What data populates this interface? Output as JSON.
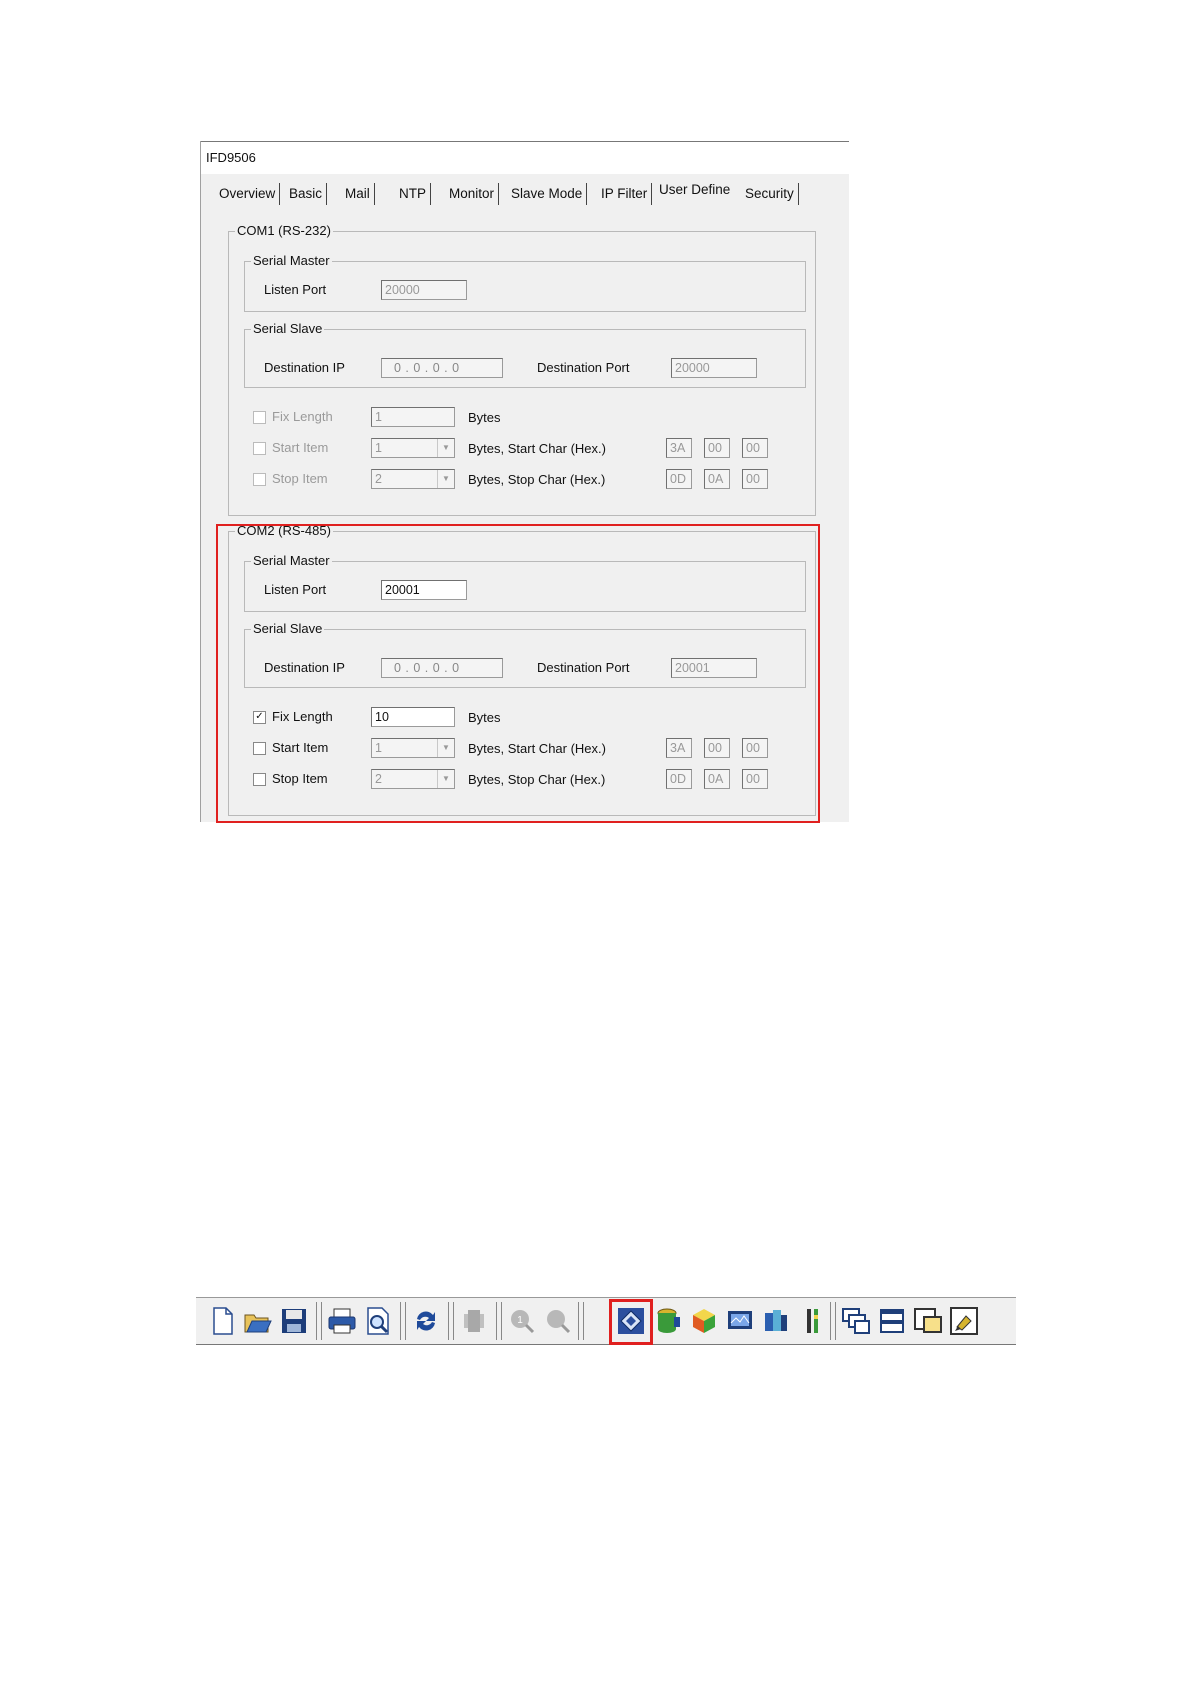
{
  "window": {
    "title": "IFD9506"
  },
  "tabs": [
    "Overview",
    "Basic",
    "Mail",
    "NTP",
    "Monitor",
    "Slave Mode",
    "IP Filter",
    "User Define",
    "Security"
  ],
  "com1": {
    "title": "COM1 (RS-232)",
    "serial_master": {
      "title": "Serial Master",
      "listen_port_label": "Listen Port",
      "listen_port": "20000"
    },
    "serial_slave": {
      "title": "Serial Slave",
      "dest_ip_label": "Destination IP",
      "dest_ip": "0 . 0 . 0 . 0",
      "dest_port_label": "Destination Port",
      "dest_port": "20000"
    },
    "fix_length": {
      "label": "Fix Length",
      "value": "1",
      "unit": "Bytes",
      "checked": false
    },
    "start_item": {
      "label": "Start Item",
      "value": "1",
      "unit": "Bytes,  Start Char (Hex.)",
      "chars": [
        "3A",
        "00",
        "00"
      ],
      "checked": false
    },
    "stop_item": {
      "label": "Stop Item",
      "value": "2",
      "unit": "Bytes,  Stop Char (Hex.)",
      "chars": [
        "0D",
        "0A",
        "00"
      ],
      "checked": false
    }
  },
  "com2": {
    "title": "COM2 (RS-485)",
    "serial_master": {
      "title": "Serial Master",
      "listen_port_label": "Listen Port",
      "listen_port": "20001"
    },
    "serial_slave": {
      "title": "Serial Slave",
      "dest_ip_label": "Destination IP",
      "dest_ip": "0 . 0 . 0 . 0",
      "dest_port_label": "Destination Port",
      "dest_port": "20001"
    },
    "fix_length": {
      "label": "Fix Length",
      "value": "10",
      "unit": "Bytes",
      "checked": true
    },
    "start_item": {
      "label": "Start Item",
      "value": "1",
      "unit": "Bytes,  Start Char (Hex.)",
      "chars": [
        "3A",
        "00",
        "00"
      ],
      "checked": false
    },
    "stop_item": {
      "label": "Stop Item",
      "value": "2",
      "unit": "Bytes,  Stop Char (Hex.)",
      "chars": [
        "0D",
        "0A",
        "00"
      ],
      "checked": false
    }
  },
  "toolbar": {
    "icons": [
      "new-icon",
      "open-icon",
      "save-icon",
      "print-icon",
      "print-preview-icon",
      "refresh-icon",
      "device-icon",
      "search-icon",
      "search-all-icon",
      "network-config-icon",
      "database-icon",
      "module-icon",
      "monitor-icon",
      "tools-icon",
      "io-icon",
      "cascade-icon",
      "tile-icon",
      "window-icon",
      "about-icon"
    ],
    "highlighted": "network-config-icon"
  },
  "colors": {
    "highlight": "#e0201f",
    "dialog_bg": "#f0f0f0"
  }
}
